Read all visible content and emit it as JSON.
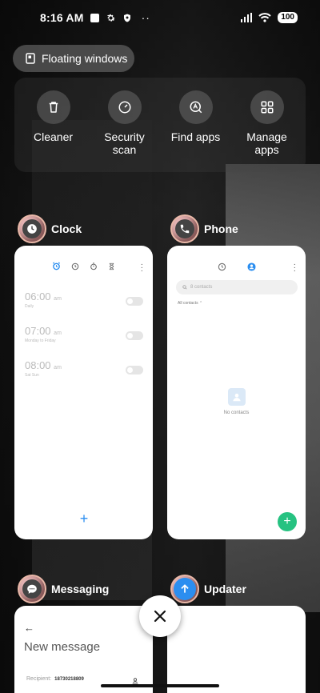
{
  "status_bar": {
    "time": "8:16 AM",
    "battery": "100",
    "icons": [
      "screen-record-icon",
      "gear-icon",
      "shield-icon",
      "more-dots-icon",
      "signal-icon",
      "wifi-icon",
      "battery-icon"
    ]
  },
  "floating_windows": {
    "label": "Floating windows"
  },
  "quick_actions": [
    {
      "label": "Cleaner",
      "icon": "trash-icon"
    },
    {
      "label": "Security\nscan",
      "icon": "gauge-icon"
    },
    {
      "label": "Find apps",
      "icon": "find-apps-icon"
    },
    {
      "label": "Manage\napps",
      "icon": "grid-icon"
    }
  ],
  "apps": {
    "clock": {
      "name": "Clock",
      "alarms": [
        {
          "time": "06:00",
          "ampm": "am",
          "repeat": "Daily"
        },
        {
          "time": "07:00",
          "ampm": "am",
          "repeat": "Monday to Friday"
        },
        {
          "time": "08:00",
          "ampm": "am",
          "repeat": "Sat Sun"
        }
      ]
    },
    "phone": {
      "name": "Phone",
      "search_placeholder": "8 contacts",
      "filter": "All contacts",
      "empty_text": "No contacts"
    },
    "messaging": {
      "name": "Messaging",
      "title": "New message",
      "recipient_label": "Recipient:",
      "recipient_value": "18730218809"
    },
    "updater": {
      "name": "Updater"
    }
  },
  "colors": {
    "accent_blue": "#2b8ef0",
    "fab_green": "#26c281",
    "card_bg": "#ffffff"
  }
}
